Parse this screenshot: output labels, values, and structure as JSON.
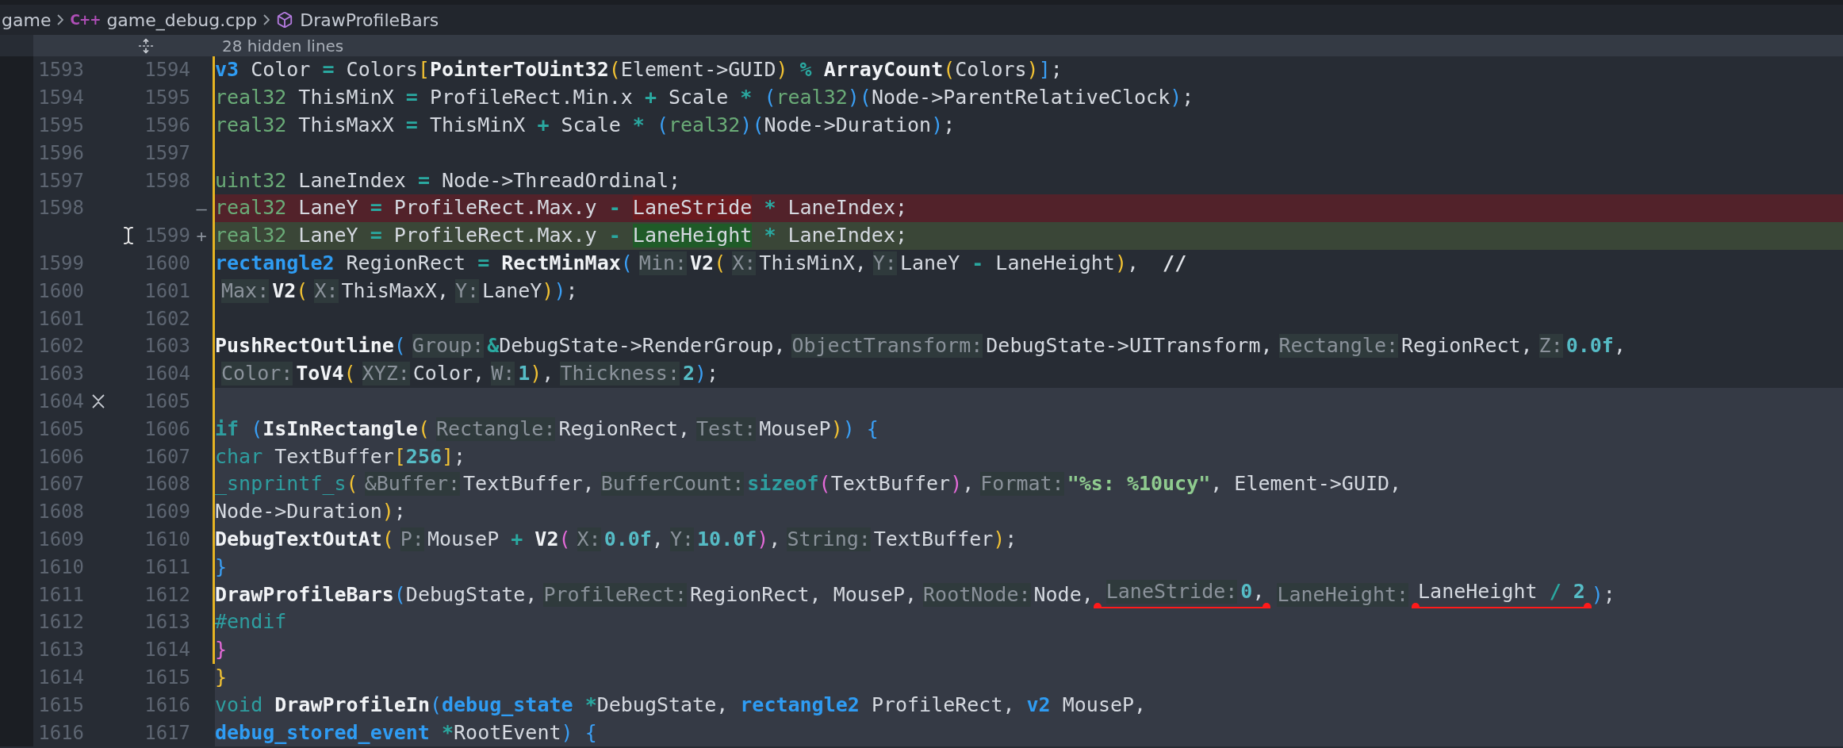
{
  "breadcrumb": [
    {
      "kind": "folder",
      "label": "game"
    },
    {
      "kind": "file",
      "icon_text": "C++",
      "label": "game_debug.cpp"
    },
    {
      "kind": "symbol",
      "label": "DrawProfileBars"
    }
  ],
  "hidden_lines": "28 hidden lines",
  "lines": [
    {
      "old": "1593",
      "new": "1594",
      "kind": "context",
      "modified": true,
      "highlighted": false,
      "tokens": [
        {
          "t": "        v3",
          "kind": "typeb"
        },
        {
          "t": " Color ",
          "kind": "text"
        },
        {
          "t": "=",
          "kind": "op"
        },
        {
          "t": " Colors",
          "kind": "text"
        },
        {
          "t": "[",
          "kind": "b1"
        },
        {
          "t": "PointerToUint32",
          "kind": "fn"
        },
        {
          "t": "(",
          "kind": "b1"
        },
        {
          "t": "Element->GUID",
          "kind": "text"
        },
        {
          "t": ")",
          "kind": "b1"
        },
        {
          "t": " %",
          "kind": "op"
        },
        {
          "t": " ArrayCount",
          "kind": "fn"
        },
        {
          "t": "(",
          "kind": "b1"
        },
        {
          "t": "Colors",
          "kind": "text"
        },
        {
          "t": ")",
          "kind": "b1"
        },
        {
          "t": "]",
          "kind": "b2"
        },
        {
          "t": ";",
          "kind": "text"
        }
      ]
    },
    {
      "old": "1594",
      "new": "1595",
      "kind": "context",
      "modified": true,
      "highlighted": false,
      "tokens": [
        {
          "t": "        real32",
          "kind": "type"
        },
        {
          "t": " ThisMinX ",
          "kind": "text"
        },
        {
          "t": "=",
          "kind": "op"
        },
        {
          "t": " ProfileRect.Min.x ",
          "kind": "text"
        },
        {
          "t": "+",
          "kind": "op"
        },
        {
          "t": " Scale ",
          "kind": "text"
        },
        {
          "t": "*",
          "kind": "op"
        },
        {
          "t": " (",
          "kind": "b2"
        },
        {
          "t": "real32",
          "kind": "type"
        },
        {
          "t": ")",
          "kind": "b2"
        },
        {
          "t": "(",
          "kind": "b2"
        },
        {
          "t": "Node->ParentRelativeClock",
          "kind": "text"
        },
        {
          "t": ")",
          "kind": "b2"
        },
        {
          "t": ";",
          "kind": "text"
        }
      ]
    },
    {
      "old": "1595",
      "new": "1596",
      "kind": "context",
      "modified": true,
      "highlighted": false,
      "tokens": [
        {
          "t": "        real32",
          "kind": "type"
        },
        {
          "t": " ThisMaxX ",
          "kind": "text"
        },
        {
          "t": "=",
          "kind": "op"
        },
        {
          "t": " ThisMinX ",
          "kind": "text"
        },
        {
          "t": "+",
          "kind": "op"
        },
        {
          "t": " Scale ",
          "kind": "text"
        },
        {
          "t": "*",
          "kind": "op"
        },
        {
          "t": " (",
          "kind": "b2"
        },
        {
          "t": "real32",
          "kind": "type"
        },
        {
          "t": ")",
          "kind": "b2"
        },
        {
          "t": "(",
          "kind": "b2"
        },
        {
          "t": "Node->Duration",
          "kind": "text"
        },
        {
          "t": ")",
          "kind": "b2"
        },
        {
          "t": ";",
          "kind": "text"
        }
      ]
    },
    {
      "old": "1596",
      "new": "1597",
      "kind": "context",
      "modified": true,
      "highlighted": false
    },
    {
      "old": "1597",
      "new": "1598",
      "kind": "context",
      "modified": true,
      "highlighted": false,
      "tokens": [
        {
          "t": "        uint32",
          "kind": "type"
        },
        {
          "t": " LaneIndex ",
          "kind": "text"
        },
        {
          "t": "=",
          "kind": "op"
        },
        {
          "t": " Node->ThreadOrdinal;",
          "kind": "text"
        }
      ]
    },
    {
      "old": "1598",
      "sign": "—",
      "kind": "deleted",
      "modified": true,
      "highlighted": false,
      "tokens": [
        {
          "t": "        real32",
          "kind": "type"
        },
        {
          "t": " LaneY ",
          "kind": "text"
        },
        {
          "t": "=",
          "kind": "op"
        },
        {
          "t": " ProfileRect.Max.y ",
          "kind": "text"
        },
        {
          "t": "- ",
          "kind": "op"
        },
        {
          "t": "LaneStride",
          "kind": "del"
        },
        {
          "t": " *",
          "kind": "op"
        },
        {
          "t": " LaneIndex;",
          "kind": "text"
        }
      ]
    },
    {
      "new": "1599",
      "sign": "+",
      "kind": "added",
      "modified": true,
      "highlighted": false,
      "tokens": [
        {
          "t": "        real32",
          "kind": "type"
        },
        {
          "t": " LaneY ",
          "kind": "text"
        },
        {
          "t": "=",
          "kind": "op"
        },
        {
          "t": " ProfileRect.Max.y ",
          "kind": "text"
        },
        {
          "t": "- ",
          "kind": "op"
        },
        {
          "t": "LaneHeight",
          "kind": "ins"
        },
        {
          "t": " *",
          "kind": "op"
        },
        {
          "t": " LaneIndex;",
          "kind": "text"
        }
      ]
    },
    {
      "old": "1599",
      "new": "1600",
      "kind": "context",
      "modified": true,
      "highlighted": false,
      "tokens": [
        {
          "t": "        rectangle2",
          "kind": "typeb"
        },
        {
          "t": " RegionRect ",
          "kind": "text"
        },
        {
          "t": "=",
          "kind": "op"
        },
        {
          "t": " RectMinMax",
          "kind": "fn"
        },
        {
          "t": "(",
          "kind": "b2"
        },
        {
          "t": "Min:",
          "kind": "hint"
        },
        {
          "t": "V2",
          "kind": "fn"
        },
        {
          "t": "(",
          "kind": "b1"
        },
        {
          "t": "X:",
          "kind": "hint"
        },
        {
          "t": "ThisMinX,",
          "kind": "text"
        },
        {
          "t": "Y:",
          "kind": "hint"
        },
        {
          "t": "LaneY ",
          "kind": "text"
        },
        {
          "t": "-",
          "kind": "op"
        },
        {
          "t": " LaneHeight",
          "kind": "text"
        },
        {
          "t": ")",
          "kind": "b1"
        },
        {
          "t": ",",
          "kind": "text"
        },
        {
          "t": "  //",
          "kind": "comment"
        }
      ]
    },
    {
      "old": "1600",
      "new": "1601",
      "kind": "context",
      "modified": true,
      "highlighted": false,
      "tokens": [
        {
          "t": "                                   Max:",
          "kind": "hint"
        },
        {
          "t": "V2",
          "kind": "fn"
        },
        {
          "t": "(",
          "kind": "b1"
        },
        {
          "t": "X:",
          "kind": "hint"
        },
        {
          "t": "ThisMaxX,",
          "kind": "text"
        },
        {
          "t": "Y:",
          "kind": "hint"
        },
        {
          "t": "LaneY",
          "kind": "text"
        },
        {
          "t": ")",
          "kind": "b1"
        },
        {
          "t": ")",
          "kind": "b2"
        },
        {
          "t": ";",
          "kind": "text"
        }
      ]
    },
    {
      "old": "1601",
      "new": "1602",
      "kind": "context",
      "modified": true,
      "highlighted": false
    },
    {
      "old": "1602",
      "new": "1603",
      "kind": "context",
      "modified": true,
      "highlighted": false,
      "tokens": [
        {
          "t": "        PushRectOutline",
          "kind": "fn"
        },
        {
          "t": "(",
          "kind": "b2"
        },
        {
          "t": "Group:",
          "kind": "hint"
        },
        {
          "t": "&",
          "kind": "op"
        },
        {
          "t": "DebugState->RenderGroup,",
          "kind": "text"
        },
        {
          "t": "ObjectTransform:",
          "kind": "hint"
        },
        {
          "t": "DebugState->UITransform,",
          "kind": "text"
        },
        {
          "t": "Rectangle:",
          "kind": "hint"
        },
        {
          "t": "RegionRect,",
          "kind": "text"
        },
        {
          "t": "Z:",
          "kind": "hint"
        },
        {
          "t": "0.0f",
          "kind": "num"
        },
        {
          "t": ",",
          "kind": "text"
        }
      ]
    },
    {
      "old": "1603",
      "new": "1604",
      "kind": "context",
      "modified": true,
      "highlighted": false,
      "tokens": [
        {
          "t": "                        Color:",
          "kind": "hint"
        },
        {
          "t": "ToV4",
          "kind": "fn"
        },
        {
          "t": "(",
          "kind": "b1"
        },
        {
          "t": "XYZ:",
          "kind": "hint"
        },
        {
          "t": "Color,",
          "kind": "text"
        },
        {
          "t": "W:",
          "kind": "hint"
        },
        {
          "t": "1",
          "kind": "num"
        },
        {
          "t": ")",
          "kind": "b1"
        },
        {
          "t": ",",
          "kind": "text"
        },
        {
          "t": "Thickness:",
          "kind": "hint"
        },
        {
          "t": "2",
          "kind": "num"
        },
        {
          "t": ")",
          "kind": "b2"
        },
        {
          "t": ";",
          "kind": "text"
        }
      ]
    },
    {
      "old": "1604",
      "new": "1605",
      "kind": "context",
      "modified": true,
      "highlighted": true
    },
    {
      "old": "1605",
      "new": "1606",
      "kind": "context",
      "modified": true,
      "highlighted": true,
      "tokens": [
        {
          "t": "        if",
          "kind": "kwb"
        },
        {
          "t": " (",
          "kind": "b2"
        },
        {
          "t": "IsInRectangle",
          "kind": "fn"
        },
        {
          "t": "(",
          "kind": "b1"
        },
        {
          "t": "Rectangle:",
          "kind": "hint"
        },
        {
          "t": "RegionRect,",
          "kind": "text"
        },
        {
          "t": "Test:",
          "kind": "hint"
        },
        {
          "t": "MouseP",
          "kind": "text"
        },
        {
          "t": ")",
          "kind": "b1"
        },
        {
          "t": ")",
          "kind": "b2"
        },
        {
          "t": " {",
          "kind": "b2"
        }
      ]
    },
    {
      "old": "1606",
      "new": "1607",
      "kind": "context",
      "modified": true,
      "highlighted": true,
      "tokens": [
        {
          "t": "            char",
          "kind": "kw"
        },
        {
          "t": " TextBuffer",
          "kind": "text"
        },
        {
          "t": "[",
          "kind": "b1"
        },
        {
          "t": "256",
          "kind": "num"
        },
        {
          "t": "]",
          "kind": "b1"
        },
        {
          "t": ";",
          "kind": "text"
        }
      ]
    },
    {
      "old": "1607",
      "new": "1608",
      "kind": "context",
      "modified": true,
      "highlighted": true,
      "tokens": [
        {
          "t": "            _snprintf_s",
          "kind": "kw"
        },
        {
          "t": "(",
          "kind": "b1"
        },
        {
          "t": "&Buffer:",
          "kind": "hint"
        },
        {
          "t": "TextBuffer,",
          "kind": "text"
        },
        {
          "t": "BufferCount:",
          "kind": "hint"
        },
        {
          "t": "sizeof",
          "kind": "kwb"
        },
        {
          "t": "(",
          "kind": "b3"
        },
        {
          "t": "TextBuffer",
          "kind": "text"
        },
        {
          "t": ")",
          "kind": "b3"
        },
        {
          "t": ",",
          "kind": "text"
        },
        {
          "t": "Format:",
          "kind": "hint"
        },
        {
          "t": "\"%s: %10ucy\"",
          "kind": "str"
        },
        {
          "t": ", Element->GUID,",
          "kind": "text"
        }
      ]
    },
    {
      "old": "1608",
      "new": "1609",
      "kind": "context",
      "modified": true,
      "highlighted": true,
      "tokens": [
        {
          "t": "                        Node->Duration",
          "kind": "text"
        },
        {
          "t": ")",
          "kind": "b1"
        },
        {
          "t": ";",
          "kind": "text"
        }
      ]
    },
    {
      "old": "1609",
      "new": "1610",
      "kind": "context",
      "modified": true,
      "highlighted": true,
      "tokens": [
        {
          "t": "            DebugTextOutAt",
          "kind": "fn"
        },
        {
          "t": "(",
          "kind": "b1"
        },
        {
          "t": "P:",
          "kind": "hint"
        },
        {
          "t": "MouseP ",
          "kind": "text"
        },
        {
          "t": "+",
          "kind": "op"
        },
        {
          "t": " V2",
          "kind": "fn"
        },
        {
          "t": "(",
          "kind": "b3"
        },
        {
          "t": "X:",
          "kind": "hint"
        },
        {
          "t": "0.0f",
          "kind": "num"
        },
        {
          "t": ",",
          "kind": "text"
        },
        {
          "t": "Y:",
          "kind": "hint"
        },
        {
          "t": "10.0f",
          "kind": "num"
        },
        {
          "t": ")",
          "kind": "b3"
        },
        {
          "t": ",",
          "kind": "text"
        },
        {
          "t": "String:",
          "kind": "hint"
        },
        {
          "t": "TextBuffer",
          "kind": "text"
        },
        {
          "t": ")",
          "kind": "b1"
        },
        {
          "t": ";",
          "kind": "text"
        }
      ]
    },
    {
      "old": "1610",
      "new": "1611",
      "kind": "context",
      "modified": true,
      "highlighted": true,
      "tokens": [
        {
          "t": "        }",
          "kind": "b2"
        }
      ]
    },
    {
      "old": "1611",
      "new": "1612",
      "kind": "context",
      "modified": true,
      "highlighted": true,
      "tokens": [
        {
          "t": "        DrawProfileBars",
          "kind": "fn"
        },
        {
          "t": "(",
          "kind": "b2"
        },
        {
          "t": "DebugState,",
          "kind": "text"
        },
        {
          "t": "ProfileRect:",
          "kind": "hint"
        },
        {
          "t": "RegionRect, MouseP,",
          "kind": "text"
        },
        {
          "t": "RootNode:",
          "kind": "hint"
        },
        {
          "t": "Node,",
          "kind": "text"
        },
        {
          "kind": "underline",
          "tokens": [
            {
              "t": "LaneStride:",
              "kind": "hint"
            },
            {
              "t": "0",
              "kind": "num"
            },
            {
              "t": ",",
              "kind": "text"
            }
          ]
        },
        {
          "t": "LaneHeight:",
          "kind": "hint"
        },
        {
          "kind": "underline",
          "tokens": [
            {
              "t": "LaneHeight ",
              "kind": "text"
            },
            {
              "t": "/",
              "kind": "op"
            },
            {
              "t": " 2",
              "kind": "num"
            }
          ]
        },
        {
          "t": ")",
          "kind": "b2"
        },
        {
          "t": ";",
          "kind": "text"
        }
      ]
    },
    {
      "old": "1612",
      "new": "1613",
      "kind": "context",
      "modified": true,
      "highlighted": true,
      "tokens": [
        {
          "t": "#endif",
          "kind": "kw"
        }
      ]
    },
    {
      "old": "1613",
      "new": "1614",
      "kind": "context",
      "modified": true,
      "highlighted": true,
      "tokens": [
        {
          "t": "    }",
          "kind": "b3"
        }
      ]
    },
    {
      "old": "1614",
      "new": "1615",
      "kind": "context",
      "modified": false,
      "highlighted": true,
      "tokens": [
        {
          "t": "}",
          "kind": "b1"
        }
      ]
    },
    {
      "old": "1615",
      "new": "1616",
      "kind": "context",
      "modified": false,
      "highlighted": true,
      "tokens": [
        {
          "t": "void",
          "kind": "kw"
        },
        {
          "t": " DrawProfileIn",
          "kind": "fn"
        },
        {
          "t": "(",
          "kind": "b2"
        },
        {
          "t": "debug_state",
          "kind": "typeb"
        },
        {
          "t": " *",
          "kind": "op"
        },
        {
          "t": "DebugState,",
          "kind": "text"
        },
        {
          "t": " rectangle2",
          "kind": "typeb"
        },
        {
          "t": " ProfileRect,",
          "kind": "text"
        },
        {
          "t": " v2",
          "kind": "typeb"
        },
        {
          "t": " MouseP,",
          "kind": "text"
        }
      ]
    },
    {
      "old": "1616",
      "new": "1617",
      "kind": "context",
      "modified": false,
      "highlighted": true,
      "tokens": [
        {
          "t": "                   debug_stored_event",
          "kind": "typeb"
        },
        {
          "t": " *",
          "kind": "op"
        },
        {
          "t": "RootEvent",
          "kind": "text"
        },
        {
          "t": ")",
          "kind": "b2"
        },
        {
          "t": " {",
          "kind": "b2"
        }
      ]
    }
  ]
}
